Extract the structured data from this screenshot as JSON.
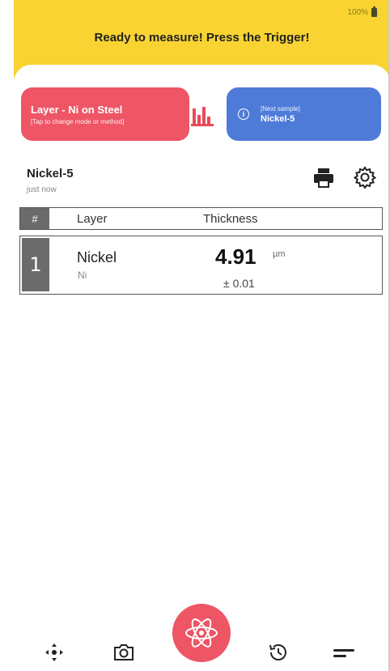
{
  "status_bar": {
    "battery": "100%"
  },
  "header": {
    "title": "Ready to measure! Press the Trigger!"
  },
  "mode_card": {
    "title": "Layer - Ni on Steel",
    "subtitle": "[Tap to change mode or method]"
  },
  "sample_card": {
    "label": "[Next sample]",
    "value": "Nickel-5"
  },
  "sample": {
    "name": "Nickel-5",
    "time": "just now"
  },
  "table": {
    "headers": {
      "index": "#",
      "layer": "Layer",
      "thickness": "Thickness"
    },
    "rows": [
      {
        "index": "1",
        "name": "Nickel",
        "symbol": "Ni",
        "value": "4.91",
        "unit": "µm",
        "error": "± 0.01"
      }
    ]
  },
  "colors": {
    "header": "#f8d331",
    "mode_card": "#ee5565",
    "sample_card": "#4f7bd8",
    "fab": "#ee5565"
  },
  "icons": [
    "chart-icon",
    "info-icon",
    "printer-icon",
    "gear-icon",
    "move-icon",
    "camera-icon",
    "atom-icon",
    "history-icon",
    "menu-icon"
  ]
}
